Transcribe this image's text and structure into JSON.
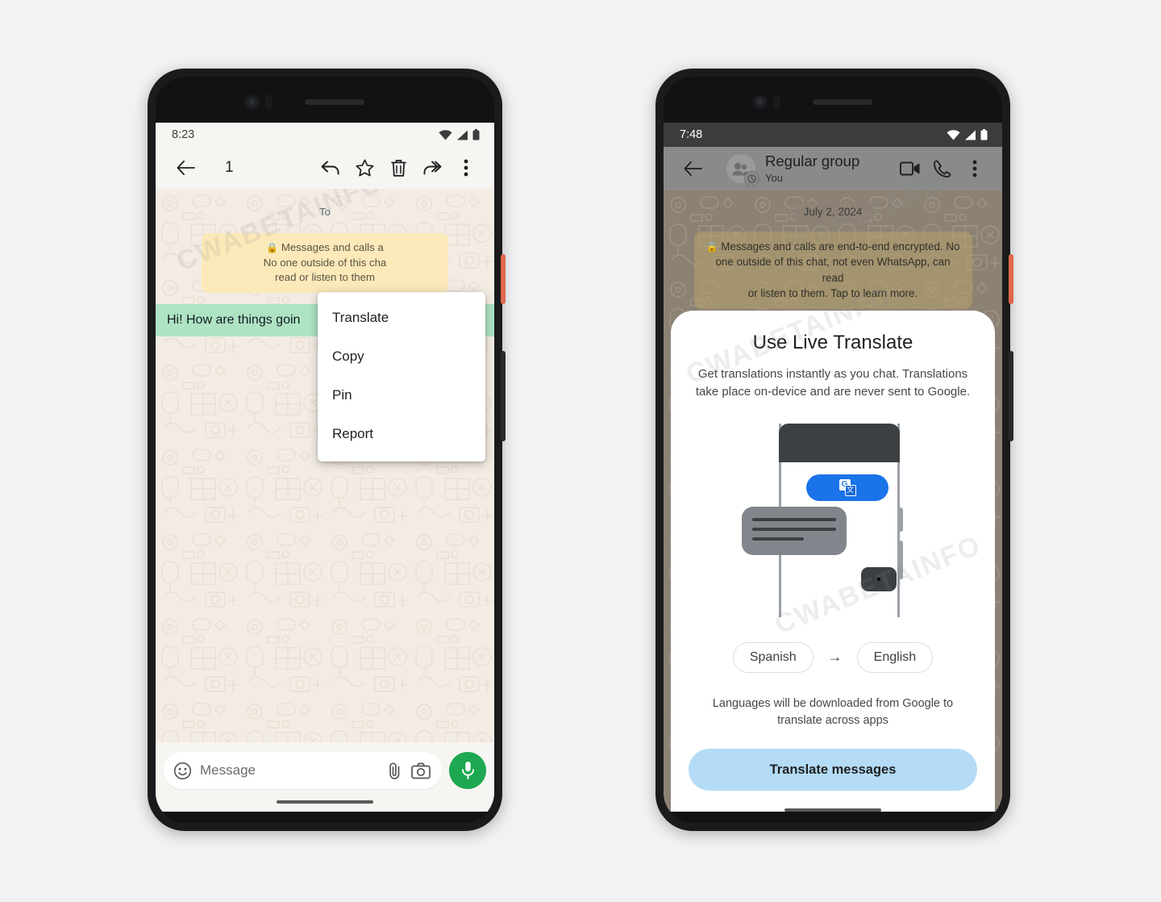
{
  "page": {
    "background_color": "#f1f2f4",
    "watermark_text": "CWABETAINFO"
  },
  "phone_left": {
    "status_bar": {
      "time": "8:23",
      "icons": [
        "wifi-icon",
        "signal-icon",
        "battery-icon"
      ]
    },
    "selection_toolbar": {
      "back_label": "back-arrow",
      "selected_count": "1",
      "actions": [
        {
          "name": "reply-icon",
          "label": "Reply"
        },
        {
          "name": "star-icon",
          "label": "Star"
        },
        {
          "name": "delete-icon",
          "label": "Delete"
        },
        {
          "name": "forward-icon",
          "label": "Forward"
        },
        {
          "name": "overflow-menu-icon",
          "label": "More options"
        }
      ]
    },
    "chat": {
      "date_chip": "To",
      "encryption_notice": "🔒 Messages and calls a\nNo one outside of this cha\nread or listen to them",
      "encryption_notice_line1": "Messages and calls a",
      "encryption_notice_line2": "No one outside of this cha",
      "encryption_notice_line3": "read or listen to them",
      "message_bubble": "Hi! How are things goin"
    },
    "context_menu": {
      "items": [
        {
          "label": "Translate"
        },
        {
          "label": "Copy"
        },
        {
          "label": "Pin"
        },
        {
          "label": "Report"
        }
      ]
    },
    "composer": {
      "emoji_icon": "emoji-icon",
      "placeholder": "Message",
      "attach_icon": "paperclip-icon",
      "camera_icon": "camera-icon",
      "mic_icon": "microphone-icon",
      "mic_button_color": "#1da851"
    }
  },
  "phone_right": {
    "status_bar": {
      "time": "7:48",
      "icons": [
        "wifi-icon",
        "signal-icon",
        "battery-icon"
      ]
    },
    "chat_header": {
      "back_label": "back-arrow",
      "title": "Regular group",
      "subtitle": "You",
      "actions": [
        {
          "name": "video-call-icon",
          "label": "Video call"
        },
        {
          "name": "voice-call-icon",
          "label": "Voice call"
        },
        {
          "name": "overflow-menu-icon",
          "label": "More options"
        }
      ]
    },
    "chat": {
      "date_chip": "July 2, 2024",
      "encryption_notice_line1": "Messages and calls are end-to-end encrypted. No",
      "encryption_notice_line2": "one outside of this chat, not even WhatsApp, can read",
      "encryption_notice_line3": "or listen to them. Tap to learn more."
    },
    "live_translate_dialog": {
      "title": "Use Live Translate",
      "description": "Get translations instantly as you chat. Translations take place on-device and are never sent to Google.",
      "illustration": {
        "translate_pill_color": "#1a73e8",
        "google_translate_icon_front": "文",
        "google_translate_icon_back": "G"
      },
      "source_language": "Spanish",
      "target_language": "English",
      "direction_arrow": "→",
      "note": "Languages will be downloaded from Google to translate across apps",
      "cta_label": "Translate messages",
      "cta_color": "#b4dcf7"
    }
  }
}
